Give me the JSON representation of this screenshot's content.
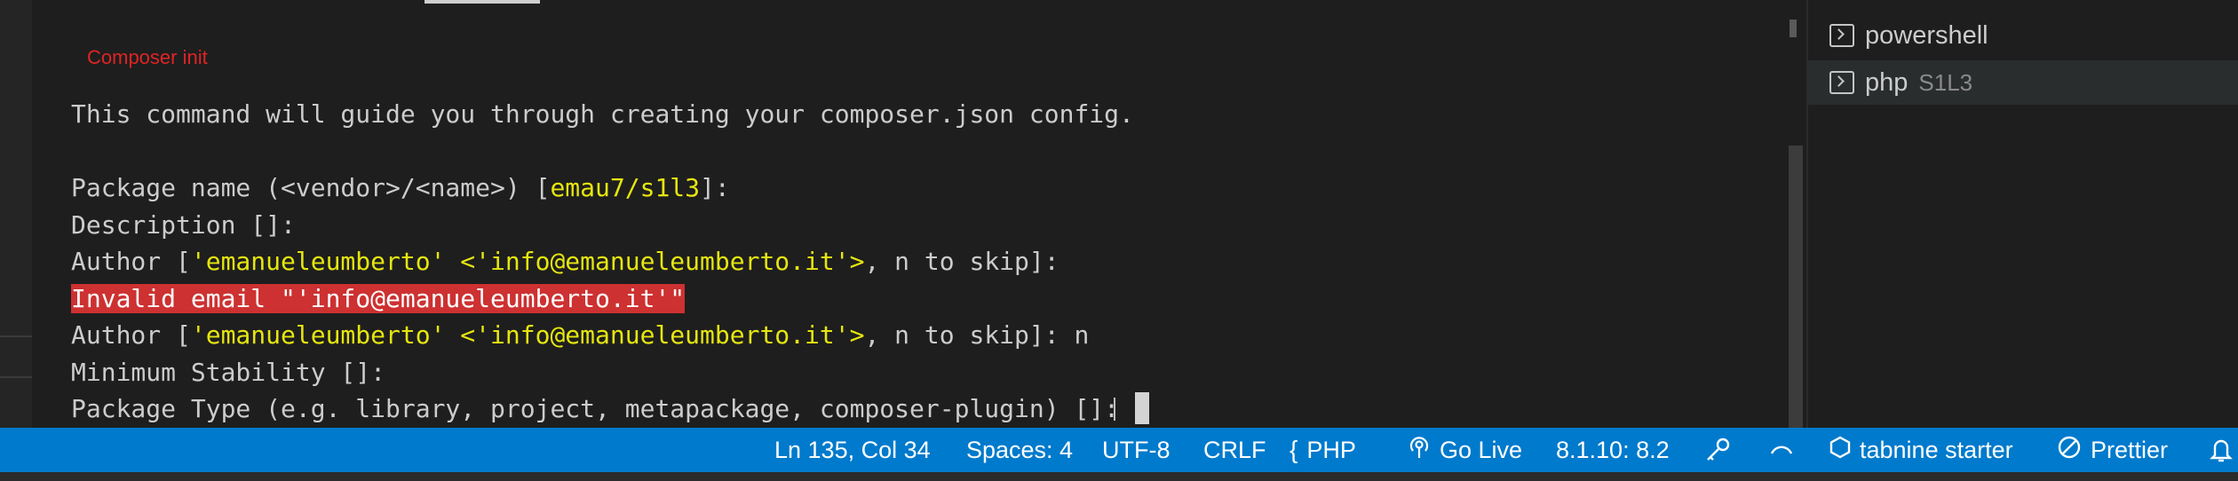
{
  "annotation": "Composer init",
  "terminal": {
    "lines": [
      {
        "segments": [
          {
            "text": "This command will guide you through creating your composer.json config."
          }
        ]
      },
      {
        "segments": [
          {
            "text": ""
          }
        ]
      },
      {
        "segments": [
          {
            "text": "Package name (<vendor>/<name>) ["
          },
          {
            "text": "emau7/s1l3",
            "hl": "yellow"
          },
          {
            "text": "]:"
          }
        ]
      },
      {
        "segments": [
          {
            "text": "Description []:"
          }
        ]
      },
      {
        "segments": [
          {
            "text": "Author ["
          },
          {
            "text": "'emanueleumberto' <'info@emanueleumberto.it'>",
            "hl": "yellow"
          },
          {
            "text": ", n to skip]:"
          }
        ]
      },
      {
        "segments": [
          {
            "text": "Invalid email \"'info@emanueleumberto.it'\"",
            "hl": "error"
          }
        ]
      },
      {
        "segments": [
          {
            "text": "Author ["
          },
          {
            "text": "'emanueleumberto' <'info@emanueleumberto.it'>",
            "hl": "yellow"
          },
          {
            "text": ", n to skip]: n"
          }
        ]
      },
      {
        "segments": [
          {
            "text": "Minimum Stability []:"
          }
        ]
      },
      {
        "segments": [
          {
            "text": "Package Type (e.g. library, project, metapackage, composer-plugin) []:"
          }
        ],
        "cursor": true
      }
    ]
  },
  "terminal_list": [
    {
      "name": "powershell",
      "detail": "",
      "active": false,
      "icon": "terminal-icon"
    },
    {
      "name": "php",
      "detail": "S1L3",
      "active": true,
      "icon": "terminal-icon"
    }
  ],
  "statusbar": {
    "position": "Ln 135, Col 34",
    "spaces": "Spaces: 4",
    "encoding": "UTF-8",
    "eol": "CRLF",
    "language_icon": "{",
    "language": "PHP",
    "go_live_icon": "broadcast-icon",
    "go_live": "Go Live",
    "php_version": "8.1.10: 8.2",
    "tabnine": "tabnine starter",
    "prettier": "Prettier"
  },
  "colors": {
    "statusbar_bg": "#007acc",
    "terminal_bg": "#1e1e1e",
    "yellow_text": "#e5e510",
    "error_bg": "#cd3131"
  }
}
